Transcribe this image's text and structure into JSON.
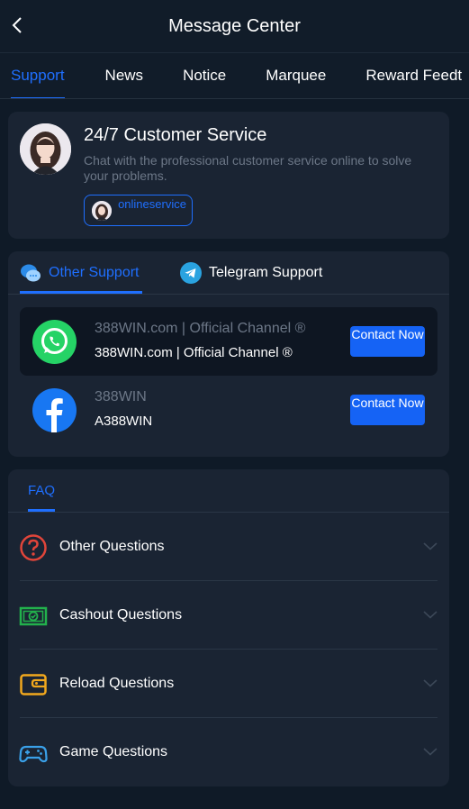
{
  "header": {
    "title": "Message Center"
  },
  "tabs": [
    {
      "label": "Support"
    },
    {
      "label": "News"
    },
    {
      "label": "Notice"
    },
    {
      "label": "Marquee"
    },
    {
      "label": "Reward Feedt"
    }
  ],
  "customer_service": {
    "title": "24/7 Customer Service",
    "description": "Chat with the professional customer service online to solve your problems.",
    "button_label": "onlineservice"
  },
  "support": {
    "tabs": [
      {
        "label": "Other Support"
      },
      {
        "label": "Telegram Support"
      }
    ],
    "channels": [
      {
        "name": "388WIN.com | Official Channel ®",
        "handle": "388WIN.com | Official Channel ®",
        "button": "Contact Now",
        "icon": "whatsapp-icon"
      },
      {
        "name": "388WIN",
        "handle": "A388WIN",
        "button": "Contact Now",
        "icon": "facebook-icon"
      }
    ]
  },
  "faq": {
    "tab_label": "FAQ",
    "items": [
      {
        "label": "Other Questions",
        "icon": "question-icon"
      },
      {
        "label": "Cashout Questions",
        "icon": "cash-icon"
      },
      {
        "label": "Reload Questions",
        "icon": "wallet-icon"
      },
      {
        "label": "Game Questions",
        "icon": "gamepad-icon"
      }
    ]
  },
  "colors": {
    "accent": "#1f6fff",
    "background": "#0f1a27",
    "card": "#1a2433"
  }
}
